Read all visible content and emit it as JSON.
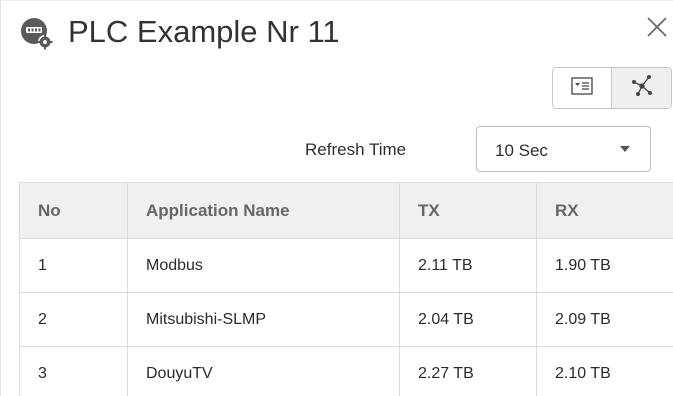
{
  "dialog": {
    "title": "PLC Example Nr 11",
    "icon": "plc-device-icon",
    "close_icon": "close-icon"
  },
  "view_toggle": {
    "items": [
      {
        "icon": "table-view-icon",
        "selected": false
      },
      {
        "icon": "topology-view-icon",
        "selected": true
      }
    ]
  },
  "refresh": {
    "label": "Refresh Time",
    "selected": "10 Sec"
  },
  "table": {
    "columns": [
      "No",
      "Application Name",
      "TX",
      "RX"
    ],
    "rows": [
      [
        "1",
        "Modbus",
        "2.11 TB",
        "1.90 TB"
      ],
      [
        "2",
        "Mitsubishi-SLMP",
        "2.04 TB",
        "2.09 TB"
      ],
      [
        "3",
        "DouyuTV",
        "2.27 TB",
        "2.10 TB"
      ]
    ]
  },
  "colors": {
    "header_bg": "#f0f0f0",
    "border": "#dcdcdc",
    "text": "#2b2b2b"
  }
}
